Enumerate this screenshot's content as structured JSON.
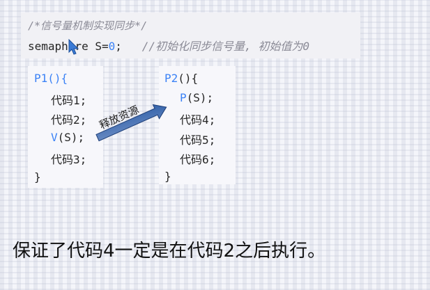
{
  "header": {
    "comment": "/*信号量机制实现同步*/",
    "declaration_code": "semaphore S=",
    "declaration_value": "0",
    "declaration_end": ";",
    "declaration_comment": "//初始化同步信号量, 初始值为0"
  },
  "p1": {
    "header": "P1(){",
    "lines": [
      "代码1;",
      "代码2;",
      "V(S);",
      "代码3;"
    ],
    "close": "}"
  },
  "p2": {
    "header": "P2(){",
    "lines": [
      "P(S);",
      "代码4;",
      "代码5;",
      "代码6;"
    ],
    "close": "}"
  },
  "arrow_label": "释放资源",
  "caption": "保证了代码4一定是在代码2之后执行。",
  "colors": {
    "keyword_blue": "#3b82f6",
    "comment_gray": "#8a8a96",
    "arrow_blue": "#2f5fa8"
  },
  "icons": {
    "cursor": "mouse-pointer-icon",
    "arrow": "arrow-right-icon"
  }
}
